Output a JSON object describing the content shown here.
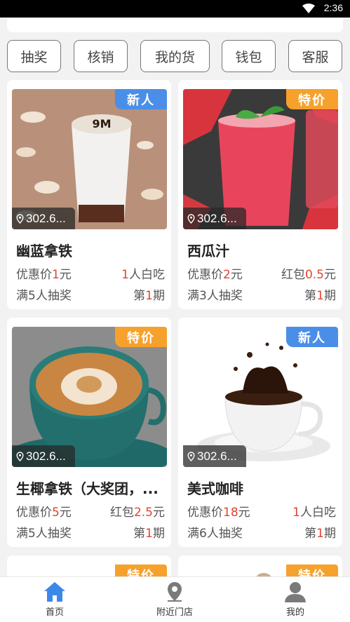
{
  "status": {
    "time": "2:36"
  },
  "quick_actions": [
    "抽奖",
    "核销",
    "我的货",
    "钱包",
    "客服"
  ],
  "colors": {
    "accent_blue": "#4a8ee8",
    "accent_orange": "#f6a12c",
    "price_red": "#e2442f"
  },
  "cards": [
    {
      "title": "幽蓝拿铁",
      "badge": "新人",
      "distance": "302.6...",
      "price_prefix": "优惠价",
      "price_value": "1",
      "price_suffix": "元",
      "reward_prefix": "",
      "reward_value": "1",
      "reward_suffix": "人白吃",
      "draw": "满5人抽奖",
      "period_prefix": "第",
      "period_value": "1",
      "period_suffix": "期"
    },
    {
      "title": "西瓜汁",
      "badge": "特价",
      "distance": "302.6...",
      "price_prefix": "优惠价",
      "price_value": "2",
      "price_suffix": "元",
      "reward_prefix": "红包",
      "reward_value": "0.5",
      "reward_suffix": "元",
      "draw": "满3人抽奖",
      "period_prefix": "第",
      "period_value": "1",
      "period_suffix": "期"
    },
    {
      "title": "生椰拿铁（大奖团，...",
      "badge": "特价",
      "distance": "302.6...",
      "price_prefix": "优惠价",
      "price_value": "5",
      "price_suffix": "元",
      "reward_prefix": "红包",
      "reward_value": "2.5",
      "reward_suffix": "元",
      "draw": "满5人抽奖",
      "period_prefix": "第",
      "period_value": "1",
      "period_suffix": "期"
    },
    {
      "title": "美式咖啡",
      "badge": "新人",
      "distance": "302.6...",
      "price_prefix": "优惠价",
      "price_value": "18",
      "price_suffix": "元",
      "reward_prefix": "",
      "reward_value": "1",
      "reward_suffix": "人白吃",
      "draw": "满6人抽奖",
      "period_prefix": "第",
      "period_value": "1",
      "period_suffix": "期"
    },
    {
      "badge": "特价"
    },
    {
      "badge": "特价"
    }
  ],
  "tabs": [
    {
      "label": "首页",
      "icon": "home-icon",
      "active": true
    },
    {
      "label": "附近门店",
      "icon": "location-pin-icon",
      "active": false
    },
    {
      "label": "我的",
      "icon": "user-icon",
      "active": false
    }
  ]
}
